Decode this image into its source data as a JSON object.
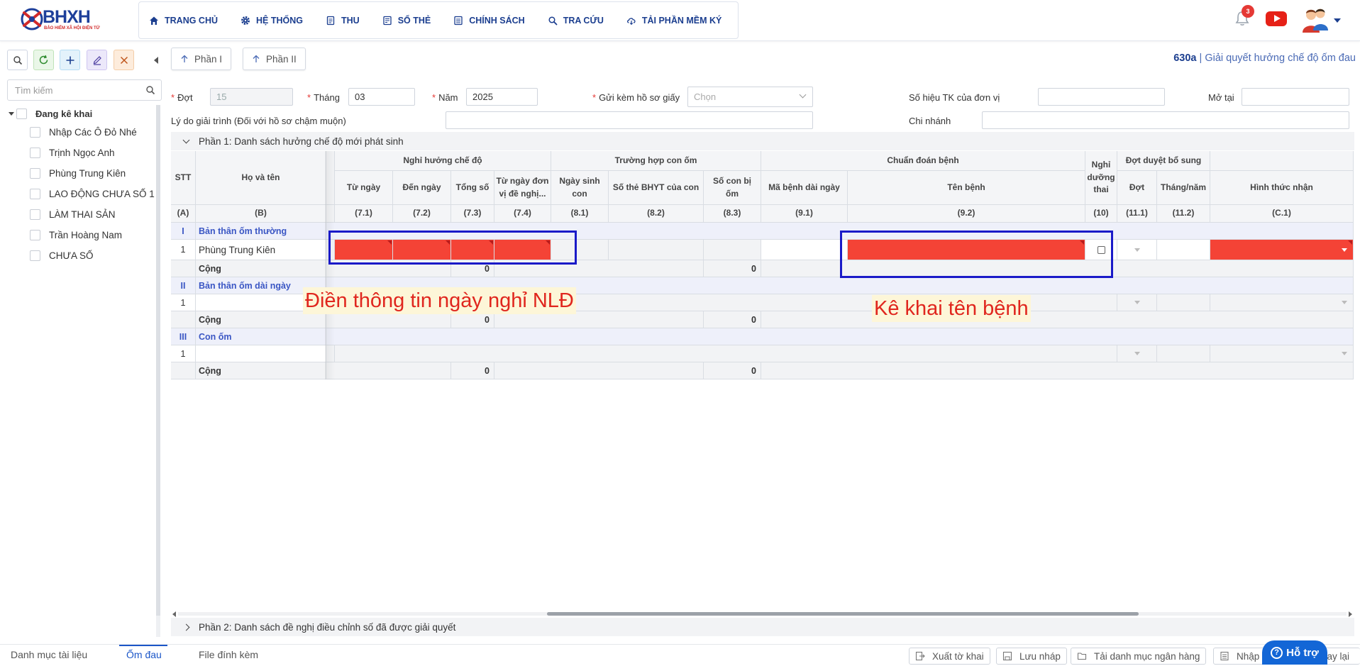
{
  "app": {
    "logo_text": "BHXH",
    "logo_subtitle": "BẢO HIỂM XÃ HỘI ĐIỆN TỬ",
    "notification_count": "3",
    "colors": {
      "primary": "#1b3e8f",
      "accent": "#1366d6",
      "error_fill": "#f44336",
      "annotation": "#1a1ac8"
    }
  },
  "nav": [
    {
      "label": "TRANG CHỦ",
      "icon": "home-icon"
    },
    {
      "label": "HỆ THỐNG",
      "icon": "gear-icon"
    },
    {
      "label": "THU",
      "icon": "document-icon"
    },
    {
      "label": "SỔ THẺ",
      "icon": "card-icon"
    },
    {
      "label": "CHÍNH SÁCH",
      "icon": "policy-icon"
    },
    {
      "label": "TRA CỨU",
      "icon": "search-icon"
    },
    {
      "label": "TẢI PHẦN MỀM KÝ",
      "icon": "cloud-download-icon"
    }
  ],
  "sidebar": {
    "search_placeholder": "Tìm kiếm",
    "tree_root": "Đang kê khai",
    "items": [
      "Nhập Các Ô Đỏ Nhé",
      "Trịnh Ngọc Anh",
      "Phùng Trung Kiên",
      "LAO ĐỘNG CHƯA SỐ 1",
      "LÀM THAI SẢN",
      "Trần Hoàng Nam",
      "CHƯA SỐ"
    ]
  },
  "parts": {
    "part1_btn": "Phần I",
    "part2_btn": "Phần II"
  },
  "form_title": {
    "code": "630a",
    "sep": " | ",
    "name": "Giải quyết hưởng chế độ ốm đau"
  },
  "form": {
    "dot_label": "Đợt",
    "dot_value": "15",
    "thang_label": "Tháng",
    "thang_value": "03",
    "nam_label": "Năm",
    "nam_value": "2025",
    "gui_kem_label": "Gửi kèm hồ sơ giấy",
    "gui_kem_placeholder": "Chọn",
    "so_hieu_label": "Số hiệu TK của đơn vị",
    "so_hieu_value": "",
    "mo_tai_label": "Mở tại",
    "mo_tai_value": "",
    "ly_do_label": "Lý do giải trình (Đối với hồ sơ chậm muộn)",
    "ly_do_value": "",
    "chi_nhanh_label": "Chi nhánh",
    "chi_nhanh_value": ""
  },
  "section1": "Phần 1: Danh sách hưởng chế độ mới phát sinh",
  "section2": "Phần 2: Danh sách đề nghị điều chỉnh số đã được giải quyết",
  "grid": {
    "h_stt": "STT",
    "h_hoten": "Họ và tên",
    "g_nghi": "Nghỉ hưởng chế độ",
    "g_truonghop": "Trường hợp con ốm",
    "g_chuandoan": "Chuẩn đoán bệnh",
    "g_nghiduong": "Nghỉ dưỡng thai",
    "g_dotduyet": "Đợt duyệt bổ sung",
    "c_tungay": "Từ ngày",
    "c_denngay": "Đến ngày",
    "c_tongso": "Tổng số",
    "c_tungaydv": "Từ ngày đơn vị đề nghị...",
    "c_ngaysinh": "Ngày sinh con",
    "c_sothe": "Số thẻ BHYT của con",
    "c_socon": "Số con bị ốm",
    "c_mabenh": "Mã bệnh dài ngày",
    "c_tenbenh": "Tên bệnh",
    "c_dot": "Đợt",
    "c_thangnam": "Tháng/năm",
    "c_hinhthuc": "Hình thức nhận",
    "codes": [
      "(A)",
      "(B)",
      "(7.1)",
      "(7.2)",
      "(7.3)",
      "(7.4)",
      "(8.1)",
      "(8.2)",
      "(8.3)",
      "(9.1)",
      "(9.2)",
      "(10)",
      "(11.1)",
      "(11.2)",
      "(C.1)"
    ],
    "groups": [
      {
        "roman": "I",
        "title": "Bản thân ốm thường",
        "row_no": "1",
        "row_name": "Phùng Trung Kiên",
        "sum_label": "Cộng",
        "sum_tongso": "0",
        "sum_socon": "0"
      },
      {
        "roman": "II",
        "title": "Bản thân ốm dài ngày",
        "row_no": "1",
        "row_name": "",
        "sum_label": "Cộng",
        "sum_tongso": "0",
        "sum_socon": "0"
      },
      {
        "roman": "III",
        "title": "Con ốm",
        "row_no": "1",
        "row_name": "",
        "sum_label": "Cộng",
        "sum_tongso": "0",
        "sum_socon": "0"
      }
    ]
  },
  "annotations": {
    "left": "Điền thông tin ngày nghỉ NLĐ",
    "right": "Kê khai tên bệnh"
  },
  "footer": {
    "tabs": [
      "Danh mục tài liệu",
      "Ốm đau",
      "File đính kèm"
    ],
    "buttons": [
      "Xuất tờ khai",
      "Lưu nháp",
      "Tải danh mục ngân hàng",
      "Nhập"
    ],
    "trailing": "uay lại",
    "help": "Hỗ trợ"
  }
}
